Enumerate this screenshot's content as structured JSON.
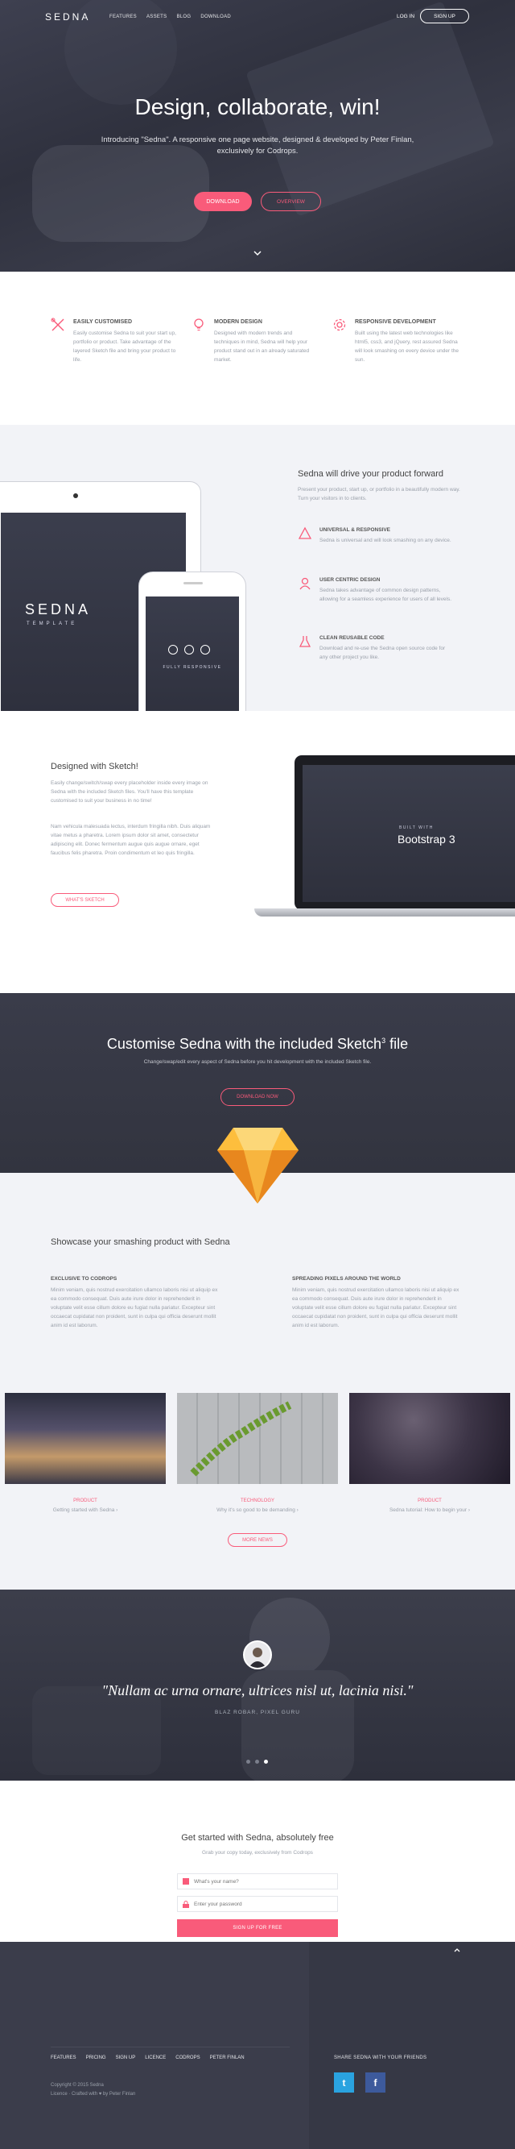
{
  "nav": {
    "logo": "SEDNA",
    "links": [
      "FEATURES",
      "ASSETS",
      "BLOG",
      "DOWNLOAD"
    ],
    "login": "LOG IN",
    "signup": "SIGN UP"
  },
  "hero": {
    "title": "Design, collaborate, win!",
    "subtitle": "Introducing \"Sedna\". A responsive one page website, designed & developed by Peter Finlan, exclusively for Codrops.",
    "download_label": "DOWNLOAD",
    "overview_label": "OVERVIEW"
  },
  "features": [
    {
      "icon": "wrench-pencil-icon",
      "title": "EASILY CUSTOMISED",
      "desc": "Easily customise Sedna to suit your start up, portfolio or product. Take advantage of the layered Sketch file and bring your product to life."
    },
    {
      "icon": "lightbulb-icon",
      "title": "MODERN DESIGN",
      "desc": "Designed with modern trends and techniques in mind, Sedna will help your product stand out in an already saturated market."
    },
    {
      "icon": "gear-icon",
      "title": "RESPONSIVE DEVELOPMENT",
      "desc": "Built using the latest web technologies like html5, css3, and jQuery, rest assured Sedna will look smashing on every device under the sun."
    }
  ],
  "product": {
    "title": "Sedna will drive your product forward",
    "desc": "Present your product, start up, or portfolio in a beautifully modern way. Turn your visitors in to clients.",
    "tablet_logo": "SEDNA",
    "tablet_sub": "TEMPLATE",
    "phone_text": "FULLY RESPONSIVE",
    "items": [
      {
        "icon": "triangle-icon",
        "title": "UNIVERSAL & RESPONSIVE",
        "desc": "Sedna is universal and will look smashing on any device."
      },
      {
        "icon": "user-icon",
        "title": "USER CENTRIC DESIGN",
        "desc": "Sedna takes advantage of common design patterns, allowing for a seamless experience for users of all levels."
      },
      {
        "icon": "flask-icon",
        "title": "CLEAN REUSABLE CODE",
        "desc": "Download and re-use the Sedna open source code for any other project you like."
      }
    ]
  },
  "sketch": {
    "title": "Designed with Sketch!",
    "p1": "Easily change/switch/swap every placeholder inside every image on Sedna with the included Sketch files. You'll have this template customised to suit your business in no time!",
    "p2": "Nam vehicula malesuada lectus, interdum fringilla nibh. Duis aliquam vitae metus a pharetra. Lorem ipsum dolor sit amet, consectetur adipiscing elit. Donec fermentum augue quis augue ornare, eget faucibus felis pharetra. Proin condimentum et leo quis fringilla.",
    "button": "WHAT'S SKETCH",
    "laptop_small": "BUILT WITH",
    "laptop_big": "Bootstrap 3"
  },
  "customise": {
    "title": "Customise Sedna with the included Sketch",
    "sup": "3",
    "title_end": "file",
    "subtitle": "Change/swap/edit every aspect of Sedna before you hit development with the included Sketch file.",
    "button": "DOWNLOAD NOW"
  },
  "showcase": {
    "title": "Showcase your smashing product with Sedna",
    "cols": [
      {
        "title": "EXCLUSIVE TO CODROPS",
        "desc": "Minim veniam, quis nostrud exercitation ullamco laboris nisi ut aliquip ex ea commodo consequat. Duis aute irure dolor in reprehenderit in voluptate velit esse cillum dolore eu fugiat nulla pariatur. Excepteur sint occaecat cupidatat non proident, sunt in culpa qui officia deserunt mollit anim id est laborum."
      },
      {
        "title": "SPREADING PIXELS AROUND THE WORLD",
        "desc": "Minim veniam, quis nostrud exercitation ullamco laboris nisi ut aliquip ex ea commodo consequat. Duis aute irure dolor in reprehenderit in voluptate velit esse cillum dolore eu fugiat nulla pariatur. Excepteur sint occaecat cupidatat non proident, sunt in culpa qui officia deserunt mollit anim id est laborum."
      }
    ],
    "cards": [
      {
        "cat": "PRODUCT",
        "title": "Getting started with Sedna ›"
      },
      {
        "cat": "TECHNOLOGY",
        "title": "Why it's so good to be demanding ›"
      },
      {
        "cat": "PRODUCT",
        "title": "Sedna tutorial: How to begin your ›"
      }
    ],
    "more": "MORE NEWS"
  },
  "testimonial": {
    "quote": "\"Nullam ac urna ornare, ultrices nisl ut, lacinia nisi.\"",
    "author": "BLAZ ROBAR, PIXEL GURU"
  },
  "signup": {
    "title": "Get started with Sedna, absolutely free",
    "subtitle": "Grab your copy today, exclusively from Codrops",
    "name_placeholder": "What's your name?",
    "pass_placeholder": "Enter your password",
    "button": "SIGN UP FOR FREE"
  },
  "footer": {
    "links": [
      "FEATURES",
      "PRICING",
      "SIGN UP",
      "LICENCE",
      "CODROPS",
      "PETER FINLAN"
    ],
    "copy1": "Copyright © 2015 Sedna",
    "copy2": "Licence · Crafted with ♥ by Peter Finlan",
    "share": "SHARE SEDNA WITH YOUR FRIENDS",
    "twitter": "t",
    "facebook": "f"
  },
  "colors": {
    "accent": "#f95b7a",
    "dark": "#3b3d4b",
    "light": "#f2f3f7",
    "twitter": "#2aa3e0",
    "facebook": "#3d5a9c"
  }
}
